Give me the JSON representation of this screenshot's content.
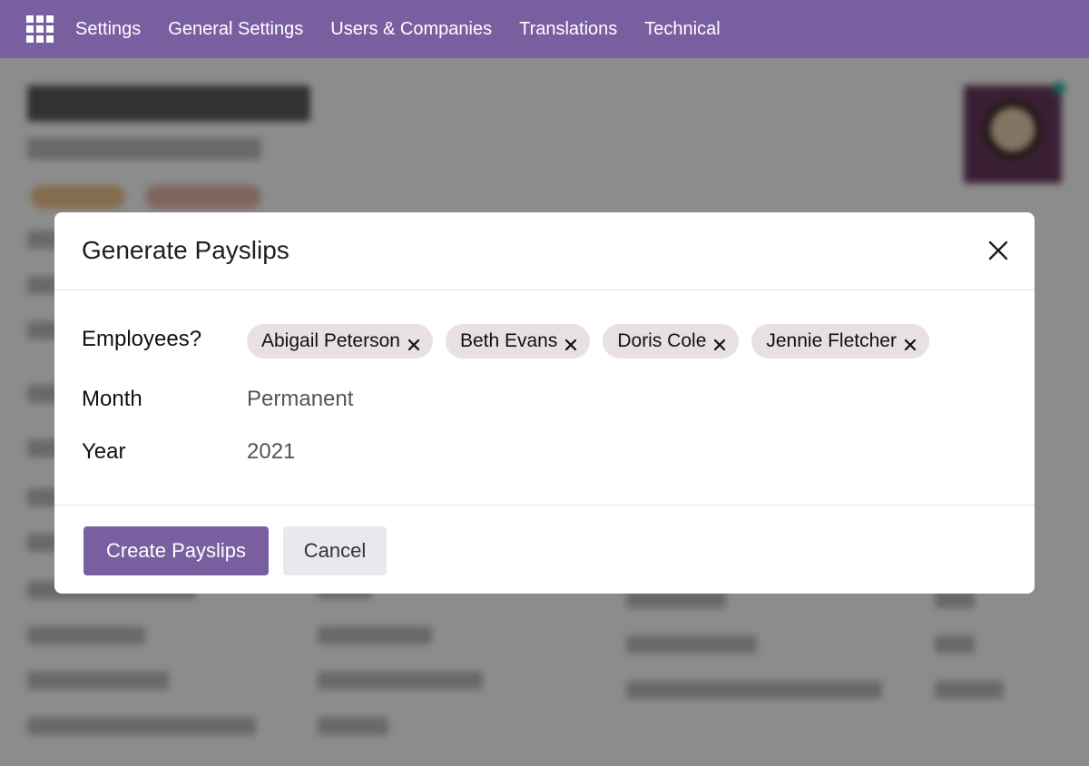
{
  "navbar": {
    "items": [
      "Settings",
      "General Settings",
      "Users & Companies",
      "Translations",
      "Technical"
    ]
  },
  "modal": {
    "title": "Generate Payslips",
    "fields": {
      "employees_label": "Employees?",
      "employees": [
        "Abigail Peterson",
        "Beth Evans",
        "Doris Cole",
        "Jennie Fletcher"
      ],
      "month_label": "Month",
      "month_value": "Permanent",
      "year_label": "Year",
      "year_value": "2021"
    },
    "buttons": {
      "primary": "Create Payslips",
      "secondary": "Cancel"
    }
  },
  "colors": {
    "brand": "#7a5fa0",
    "tag_bg": "#e9e1e1",
    "secondary_btn": "#e7e9ed"
  },
  "icons": {
    "apps": "apps-grid-icon",
    "close": "close-icon",
    "tag_remove": "remove-tag-icon"
  }
}
